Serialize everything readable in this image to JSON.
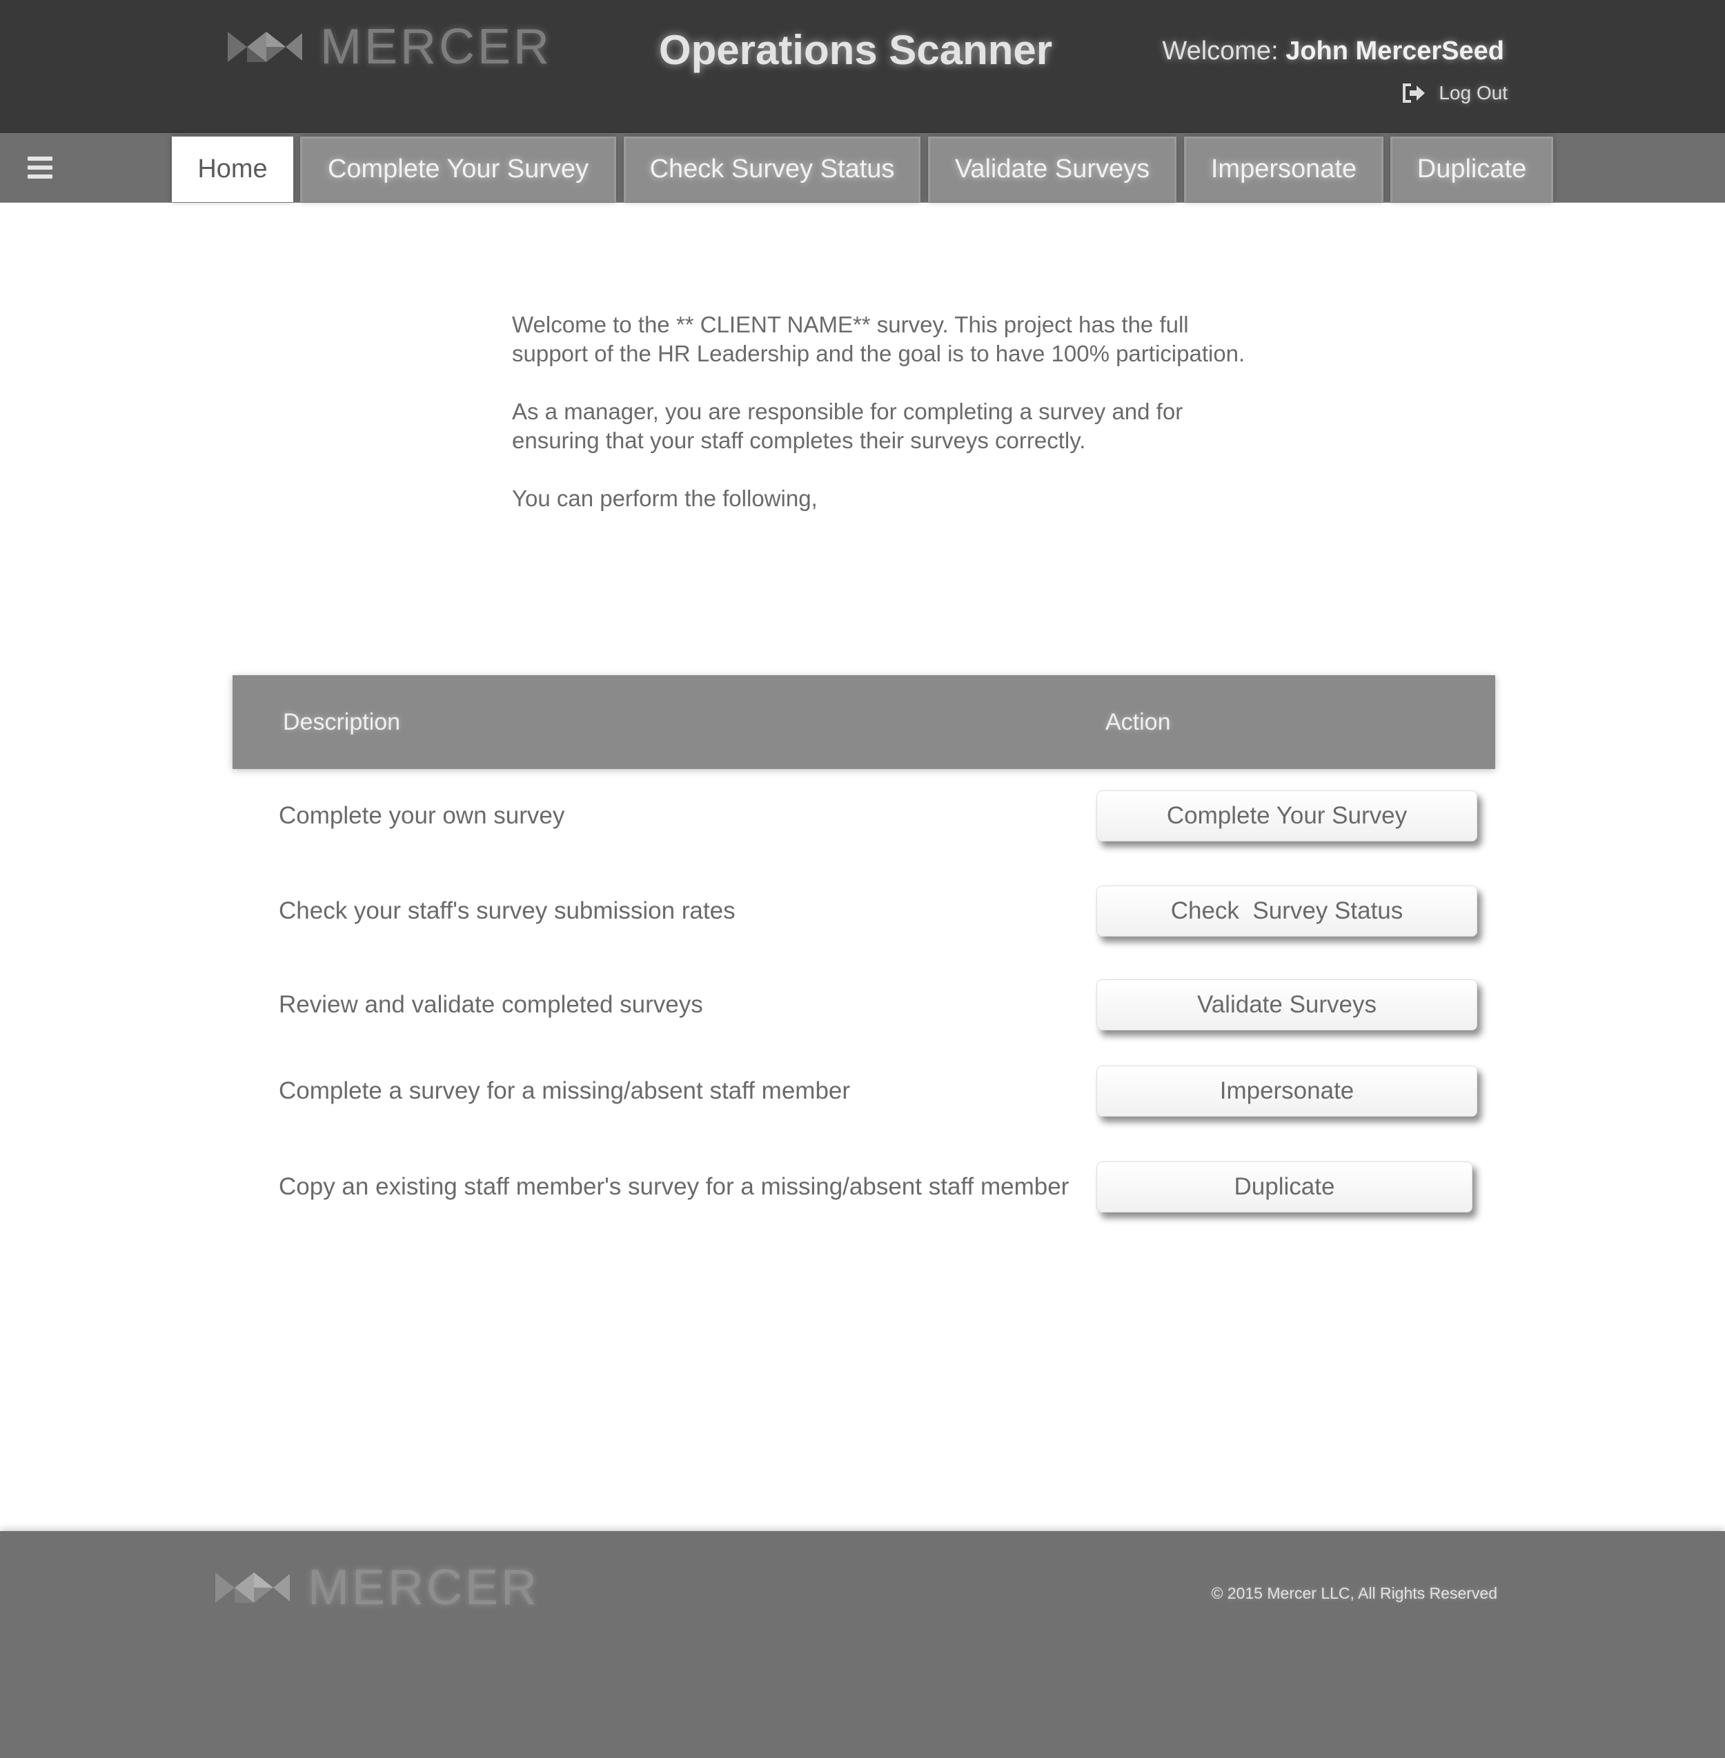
{
  "header": {
    "logo_text": "MERCER",
    "app_title": "Operations Scanner",
    "welcome_label": "Welcome:",
    "user_name": "John MercerSeed",
    "logout_label": "Log Out"
  },
  "nav": {
    "menu_icon": "hamburger-menu-icon",
    "tabs": [
      {
        "label": "Home",
        "active": true
      },
      {
        "label": "Complete Your Survey",
        "active": false
      },
      {
        "label": "Check Survey Status",
        "active": false
      },
      {
        "label": "Validate Surveys",
        "active": false
      },
      {
        "label": "Impersonate",
        "active": false
      },
      {
        "label": "Duplicate",
        "active": false
      }
    ]
  },
  "intro": {
    "paragraphs": [
      "Welcome to the ** CLIENT NAME** survey. This project has the full support of the HR Leadership and the goal is to have 100% participation.",
      "As a manager, you are responsible for completing a survey and for ensuring that your staff completes their surveys correctly.",
      "You can perform the following,"
    ]
  },
  "table": {
    "headers": {
      "description": "Description",
      "action": "Action"
    },
    "rows": [
      {
        "description": "Complete your own survey",
        "action": "Complete Your Survey"
      },
      {
        "description": "Check your staff's survey submission rates",
        "action": "Check  Survey Status"
      },
      {
        "description": "Review and validate completed surveys",
        "action": "Validate Surveys"
      },
      {
        "description": "Complete a survey for a missing/absent staff member",
        "action": "Impersonate"
      },
      {
        "description": "Copy an existing staff member's survey for a missing/absent staff member",
        "action": "Duplicate"
      }
    ]
  },
  "footer": {
    "logo_text": "MERCER",
    "copyright": "© 2015 Mercer LLC, All Rights Reserved"
  },
  "icons": {
    "logo": "mercer-logo-icon",
    "logout": "sign-out-icon",
    "menu": "hamburger-menu-icon"
  },
  "colors": {
    "header_bg": "#393939",
    "nav_bg": "#6f6f6f",
    "tab_bg": "#8d8d8d",
    "table_header_bg": "#8a8a8a",
    "footer_bg": "#717171"
  }
}
